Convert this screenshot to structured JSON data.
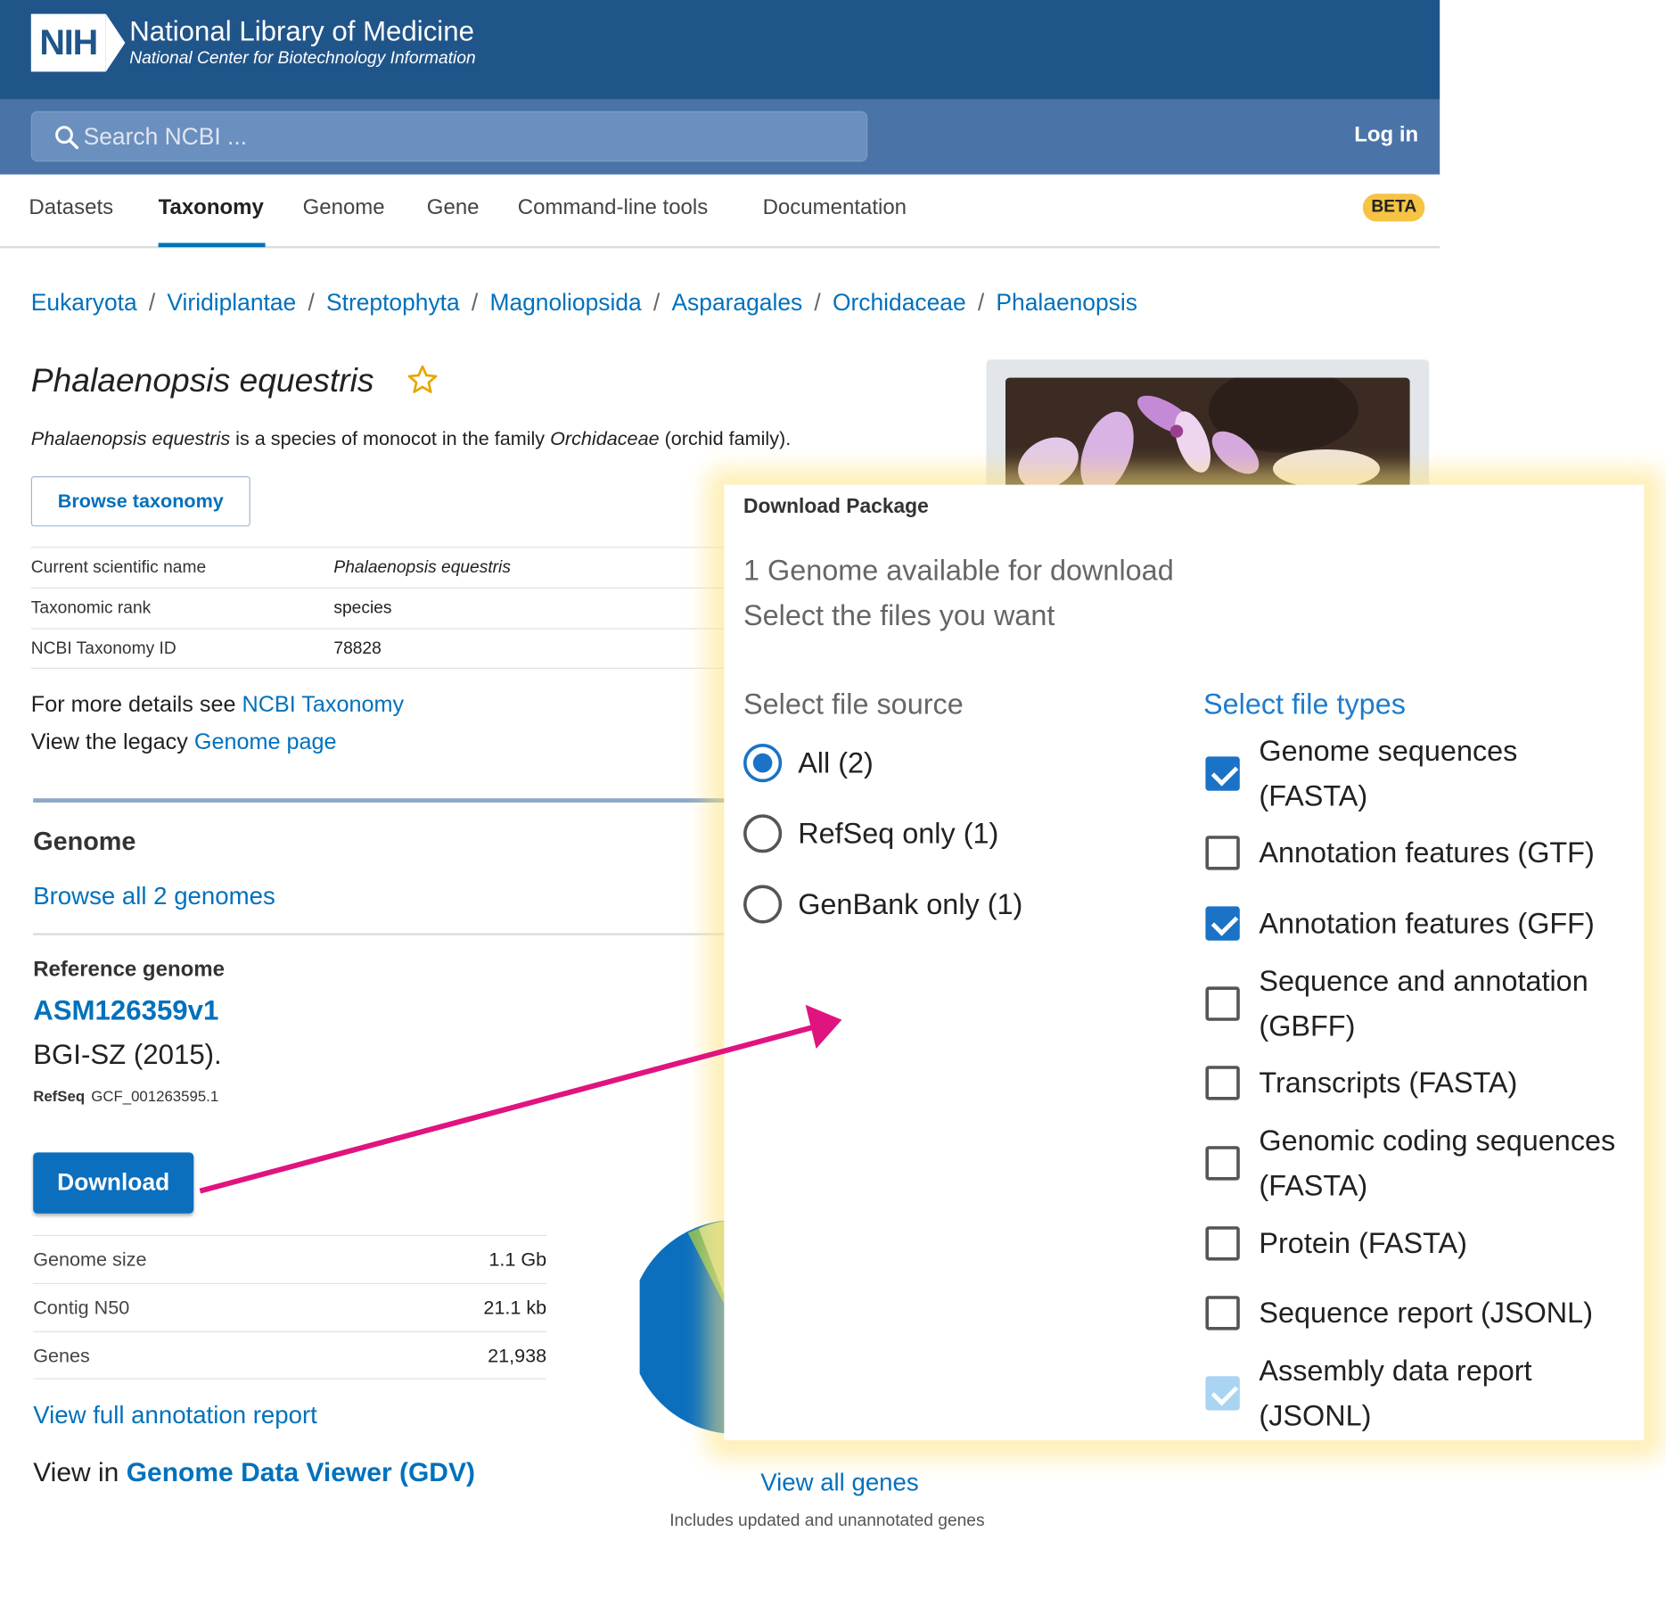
{
  "header": {
    "logo_text": "NIH",
    "title": "National Library of Medicine",
    "subtitle": "National Center for Biotechnology Information",
    "search_placeholder": "Search NCBI ...",
    "login_label": "Log in"
  },
  "nav": {
    "tabs": [
      "Datasets",
      "Taxonomy",
      "Genome",
      "Gene",
      "Command-line tools",
      "Documentation"
    ],
    "active_tab": "Taxonomy",
    "badge": "BETA"
  },
  "breadcrumb": [
    "Eukaryota",
    "Viridiplantae",
    "Streptophyta",
    "Magnoliopsida",
    "Asparagales",
    "Orchidaceae",
    "Phalaenopsis"
  ],
  "species": {
    "name": "Phalaenopsis equestris",
    "description_name": "Phalaenopsis equestris",
    "description_mid": " is a species of monocot in the family ",
    "description_family": "Orchidaceae",
    "description_end": " (orchid family).",
    "browse_taxonomy_label": "Browse taxonomy"
  },
  "info_table": [
    {
      "label": "Current scientific name",
      "value": "Phalaenopsis equestris"
    },
    {
      "label": "Taxonomic rank",
      "value": "species"
    },
    {
      "label": "NCBI Taxonomy ID",
      "value": "78828"
    }
  ],
  "details": {
    "more_prefix": "For more details see ",
    "more_link": "NCBI Taxonomy",
    "legacy_prefix": "View the legacy ",
    "legacy_link": "Genome page"
  },
  "genome": {
    "heading": "Genome",
    "browse_all": "Browse all 2 genomes",
    "reference_heading": "Reference genome",
    "assembly": "ASM126359v1",
    "submitter": "BGI-SZ (2015).",
    "refseq_label": "RefSeq",
    "refseq_accession": "GCF_001263595.1",
    "download_label": "Download",
    "stats": [
      {
        "label": "Genome size",
        "value": "1.1 Gb"
      },
      {
        "label": "Contig N50",
        "value": "21.1 kb"
      },
      {
        "label": "Genes",
        "value": "21,938"
      }
    ],
    "full_annotation": "View full annotation report",
    "view_in_prefix": "View in ",
    "gdv_link": "Genome Data Viewer (GDV)",
    "view_all_genes": "View all genes",
    "genes_note": "Includes updated and unannotated genes"
  },
  "download_panel": {
    "title": "Download Package",
    "available": "1 Genome available for download",
    "select_files": "Select the files you want",
    "source_heading": "Select file source",
    "types_heading": "Select file types",
    "sources": [
      {
        "label": "All (2)",
        "selected": true
      },
      {
        "label": "RefSeq only (1)",
        "selected": false
      },
      {
        "label": "GenBank only (1)",
        "selected": false
      }
    ],
    "file_types": [
      {
        "label": "Genome sequences (FASTA)",
        "state": "checked"
      },
      {
        "label": "Annotation features (GTF)",
        "state": "unchecked"
      },
      {
        "label": "Annotation features (GFF)",
        "state": "checked"
      },
      {
        "label": "Sequence and annotation (GBFF)",
        "state": "unchecked"
      },
      {
        "label": "Transcripts (FASTA)",
        "state": "unchecked"
      },
      {
        "label": "Genomic coding sequences (FASTA)",
        "state": "unchecked"
      },
      {
        "label": "Protein (FASTA)",
        "state": "unchecked"
      },
      {
        "label": "Sequence report (JSONL)",
        "state": "unchecked"
      },
      {
        "label": "Assembly data report (JSONL)",
        "state": "checked-disabled"
      }
    ]
  },
  "colors": {
    "header_bg": "#20558a",
    "search_bg": "#4a74a8",
    "link": "#0071bc",
    "download_button": "#0b6fbe",
    "beta_badge": "#f6c343",
    "arrow": "#e0147f",
    "panel_glow": "#fde482"
  },
  "icons": [
    "search-icon",
    "star-icon",
    "arrow-annotation"
  ]
}
